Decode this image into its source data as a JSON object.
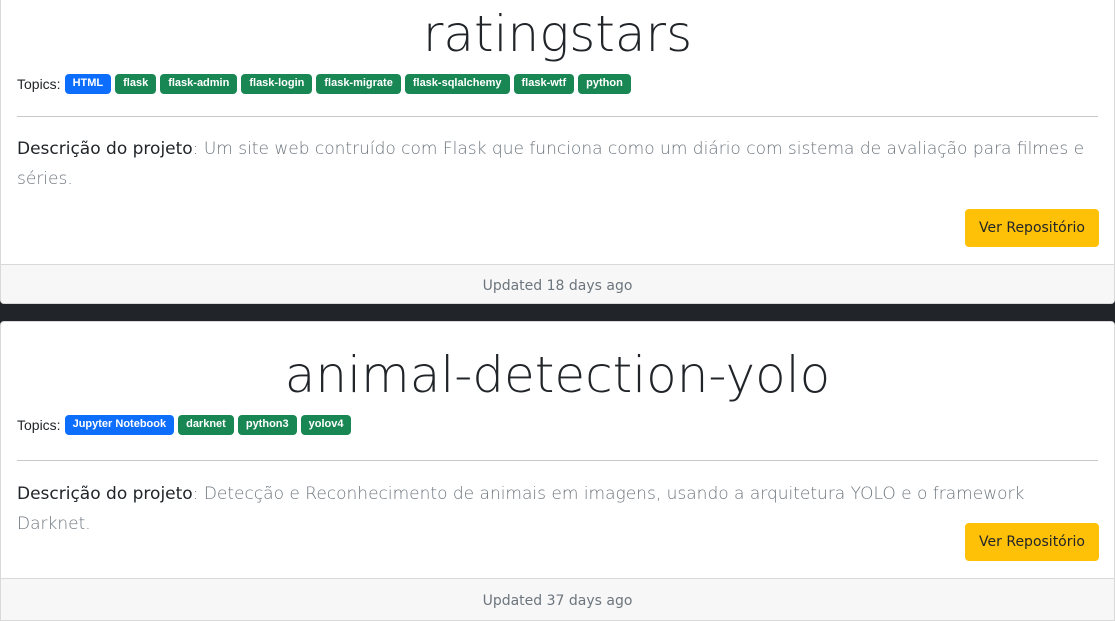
{
  "repos": [
    {
      "title": "ratingstars",
      "topics_label": "Topics:",
      "language": "HTML",
      "topics": [
        "flask",
        "flask-admin",
        "flask-login",
        "flask-migrate",
        "flask-sqlalchemy",
        "flask-wtf",
        "python"
      ],
      "description_label": "Descrição do projeto",
      "description": ": Um site web contruído com Flask que funciona como um diário com sistema de avaliação para filmes e séries.",
      "button_label": "Ver Repositório",
      "updated": "Updated 18 days ago"
    },
    {
      "title": "animal-detection-yolo",
      "topics_label": "Topics:",
      "language": "Jupyter Notebook",
      "topics": [
        "darknet",
        "python3",
        "yolov4"
      ],
      "description_label": "Descrição do projeto",
      "description": ": Detecção e Reconhecimento de animais em imagens, usando a arquitetura YOLO e o framework Darknet.",
      "button_label": "Ver Repositório",
      "updated": "Updated 37 days ago"
    }
  ],
  "colors": {
    "page_background": "#212529",
    "language_badge": "#0d6efd",
    "topic_badge": "#198754",
    "button": "#ffc107"
  }
}
